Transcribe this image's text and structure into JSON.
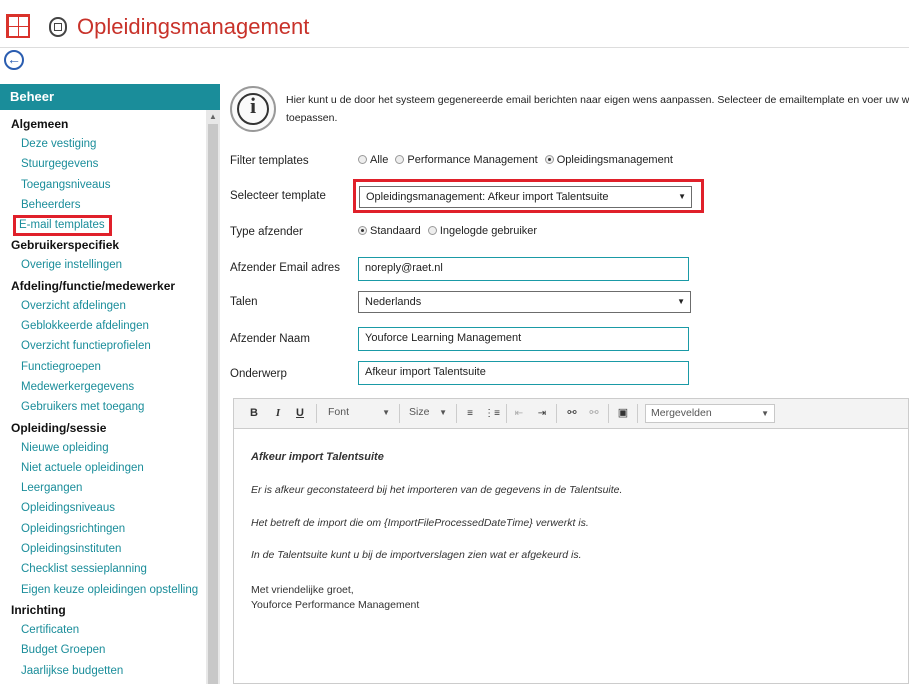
{
  "app": {
    "title": "Opleidingsmanagement",
    "accent": "#c8322a"
  },
  "sidebar": {
    "header": "Beheer",
    "groups": [
      {
        "title": "Algemeen",
        "items": [
          "Deze vestiging",
          "Stuurgegevens",
          "Toegangsniveaus",
          "Beheerders",
          "E-mail templates"
        ]
      },
      {
        "title": "Gebruikerspecifiek",
        "items": [
          "Overige instellingen"
        ]
      },
      {
        "title": "Afdeling/functie/medewerker",
        "items": [
          "Overzicht afdelingen",
          "Geblokkeerde afdelingen",
          "Overzicht functieprofielen",
          "Functiegroepen",
          "Medewerkergegevens",
          "Gebruikers met toegang"
        ]
      },
      {
        "title": "Opleiding/sessie",
        "items": [
          "Nieuwe opleiding",
          "Niet actuele opleidingen",
          "Leergangen",
          "Opleidingsniveaus",
          "Opleidingsrichtingen",
          "Opleidingsinstituten",
          "Checklist sessieplanning",
          "Eigen keuze opleidingen opstelling"
        ]
      },
      {
        "title": "Inrichting",
        "items": [
          "Certificaten",
          "Budget Groepen",
          "Jaarlijkse budgetten"
        ]
      }
    ],
    "selected": "E-mail templates"
  },
  "info": {
    "line1": "Hier kunt u de door het systeem gegenereerde email berichten naar eigen wens aanpassen. Selecteer de emailtemplate en voer uw wijzigingen",
    "line2": "toepassen."
  },
  "form": {
    "filter": {
      "label": "Filter templates",
      "options": [
        "Alle",
        "Performance Management",
        "Opleidingsmanagement"
      ],
      "selected": "Opleidingsmanagement"
    },
    "template": {
      "label": "Selecteer template",
      "value": "Opleidingsmanagement: Afkeur import Talentsuite"
    },
    "sender_type": {
      "label": "Type afzender",
      "options": [
        "Standaard",
        "Ingelogde gebruiker"
      ],
      "selected": "Standaard"
    },
    "sender_email": {
      "label": "Afzender Email adres",
      "value": "noreply@raet.nl"
    },
    "language": {
      "label": "Talen",
      "value": "Nederlands"
    },
    "sender_name": {
      "label": "Afzender Naam",
      "value": "Youforce Learning Management"
    },
    "subject": {
      "label": "Onderwerp",
      "value": "Afkeur import Talentsuite"
    }
  },
  "editor": {
    "toolbar": {
      "bold": "B",
      "italic": "I",
      "underline": "U",
      "font": "Font",
      "size": "Size",
      "mergefields": "Mergevelden"
    },
    "body": {
      "heading": "Afkeur import Talentsuite",
      "p1": "Er is afkeur geconstateerd bij het importeren van de gegevens in de Talentsuite.",
      "p2": "Het betreft de import die om {ImportFileProcessedDateTime} verwerkt is.",
      "p3": "In de Talentsuite kunt u bij de importverslagen zien wat er afgekeurd is.",
      "closing1": "Met vriendelijke groet,",
      "closing2": "Youforce Performance Management"
    }
  }
}
